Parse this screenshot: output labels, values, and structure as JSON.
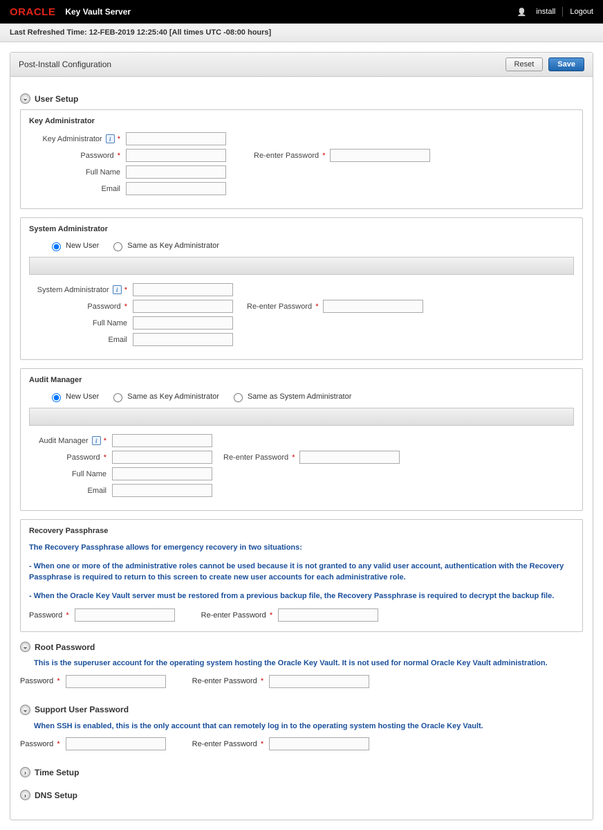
{
  "top": {
    "logo": "ORACLE",
    "product": "Key Vault Server",
    "user": "install",
    "logout": "Logout"
  },
  "refresh": "Last Refreshed Time: 12-FEB-2019 12:25:40 [All times UTC -08:00 hours]",
  "page": {
    "title": "Post-Install Configuration",
    "reset": "Reset",
    "save": "Save"
  },
  "sections": {
    "user_setup": "User Setup",
    "root_pw": "Root Password",
    "support_pw": "Support User Password",
    "time": "Time Setup",
    "dns": "DNS Setup"
  },
  "key_admin": {
    "panel_title": "Key Administrator",
    "label": "Key Administrator",
    "password": "Password",
    "repassword": "Re-enter Password",
    "fullname": "Full Name",
    "email": "Email"
  },
  "sys_admin": {
    "panel_title": "System Administrator",
    "new_user": "New User",
    "same_key": "Same as Key Administrator",
    "label": "System Administrator",
    "password": "Password",
    "repassword": "Re-enter Password",
    "fullname": "Full Name",
    "email": "Email"
  },
  "audit": {
    "panel_title": "Audit Manager",
    "new_user": "New User",
    "same_key": "Same as Key Administrator",
    "same_sys": "Same as System Administrator",
    "label": "Audit Manager",
    "password": "Password",
    "repassword": "Re-enter Password",
    "fullname": "Full Name",
    "email": "Email"
  },
  "recovery": {
    "panel_title": "Recovery Passphrase",
    "line1": "The Recovery Passphrase allows for emergency recovery in two situations:",
    "line2": "- When one or more of the administrative roles cannot be used because it is not granted to any valid user account, authentication with the Recovery Passphrase is required to return to this screen to create new user accounts for each administrative role.",
    "line3": "- When the Oracle Key Vault server must be restored from a previous backup file, the Recovery Passphrase is required to decrypt the backup file.",
    "password": "Password",
    "repassword": "Re-enter Password"
  },
  "root": {
    "desc": "This is the superuser account for the operating system hosting the Oracle Key Vault. It is not used for normal Oracle Key Vault administration.",
    "password": "Password",
    "repassword": "Re-enter Password"
  },
  "support": {
    "desc": "When SSH is enabled, this is the only account that can remotely log in to the operating system hosting the Oracle Key Vault.",
    "password": "Password",
    "repassword": "Re-enter Password"
  }
}
